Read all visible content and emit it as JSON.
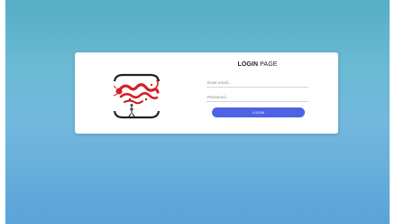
{
  "page": {
    "title_bold": "LOGIN",
    "title_rest": " PAGE"
  },
  "form": {
    "email_placeholder": "Enter email...",
    "password_placeholder": "Password...",
    "login_label": "LOGIN"
  },
  "colors": {
    "button": "#4d63e4",
    "background_top": "#55afc6",
    "background_bottom": "#5aa3d8"
  },
  "icons": {
    "logo": "dragon-logo"
  }
}
